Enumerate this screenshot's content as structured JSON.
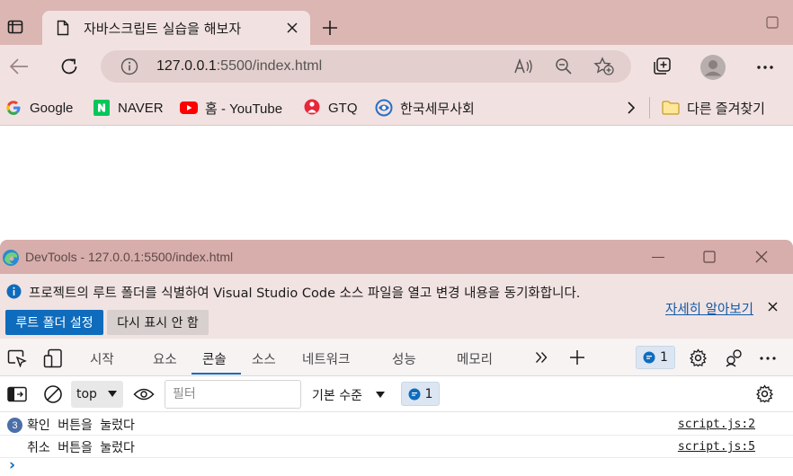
{
  "browser": {
    "tab_title": "자바스크립트 실습을 해보자",
    "url_host": "127.0.0.1",
    "url_rest": ":5500/index.html",
    "bookmarks": [
      {
        "label": "Google",
        "icon": "google-icon"
      },
      {
        "label": "NAVER",
        "icon": "naver-icon"
      },
      {
        "label": "홈 - YouTube",
        "icon": "youtube-icon"
      },
      {
        "label": "GTQ",
        "icon": "gtq-icon"
      },
      {
        "label": "한국세무사회",
        "icon": "kacpta-icon"
      }
    ],
    "other_favorites": "다른 즐겨찾기"
  },
  "devtools": {
    "title": "DevTools - 127.0.0.1:5500/index.html",
    "info_message": "프로젝트의 루트 폴더를 식별하여 Visual Studio Code 소스 파일을 열고 변경 내용을 동기화합니다.",
    "set_root_button": "루트 폴더 설정",
    "dismiss_button": "다시 표시 안 함",
    "learn_more": "자세히 알아보기",
    "tabs": [
      "시작",
      "요소",
      "콘솔",
      "소스",
      "네트워크",
      "성능",
      "메모리"
    ],
    "active_tab": "콘솔",
    "message_count": "1",
    "console": {
      "context": "top",
      "filter_placeholder": "필터",
      "levels": "기본 수준",
      "issues_count": "1",
      "logs": [
        {
          "repeat": "3",
          "text": "확인 버튼을 눌렀다",
          "source": "script.js:2"
        },
        {
          "repeat": "",
          "text": "취소 버튼을 눌렀다",
          "source": "script.js:5"
        }
      ],
      "prompt": "›"
    }
  },
  "colors": {
    "accent": "#0f6cbd",
    "titlebar": "#dbb6b3",
    "toolbar": "#f1e2e1"
  }
}
